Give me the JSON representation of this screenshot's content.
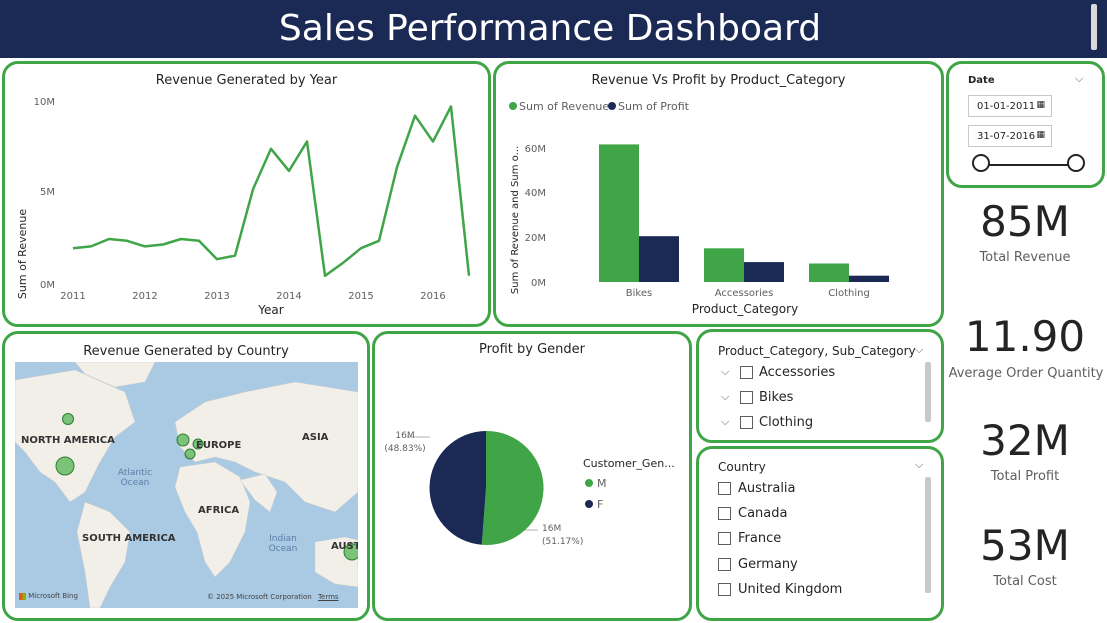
{
  "header": {
    "title": "Sales Performance Dashboard"
  },
  "colors": {
    "accent_green": "#3fa547",
    "navy": "#1b2a55",
    "border": "#3fa547"
  },
  "revenue_by_year": {
    "title": "Revenue Generated by Year",
    "xlabel": "Year",
    "ylabel": "Sum of Revenue",
    "y_ticks": [
      "0M",
      "5M",
      "10M"
    ],
    "x_ticks": [
      "2011",
      "2012",
      "2013",
      "2014",
      "2015",
      "2016"
    ]
  },
  "rev_vs_profit": {
    "title": "Revenue Vs Profit by Product_Category",
    "xlabel": "Product_Category",
    "ylabel": "Sum of Revenue and Sum o...",
    "legend": [
      "Sum of Revenue",
      "Sum of Profit"
    ],
    "y_ticks": [
      "0M",
      "20M",
      "40M",
      "60M"
    ]
  },
  "country_map": {
    "title": "Revenue Generated by Country",
    "labels": [
      "NORTH AMERICA",
      "EUROPE",
      "ASIA",
      "AFRICA",
      "SOUTH AMERICA",
      "AUST"
    ],
    "oceans": [
      "Atlantic Ocean",
      "Indian Ocean"
    ],
    "footer_brand": "Microsoft Bing",
    "footer_copyright": "© 2025 Microsoft Corporation",
    "footer_terms": "Terms"
  },
  "profit_by_gender": {
    "title": "Profit by Gender",
    "legend_title": "Customer_Gen...",
    "label_f": [
      "16M",
      "(48.83%)"
    ],
    "label_m": [
      "16M",
      "(51.17%)"
    ]
  },
  "date_slicer": {
    "title": "Date",
    "start": "01-01-2011",
    "end": "31-07-2016"
  },
  "kpis": [
    {
      "value": "85M",
      "label": "Total Revenue"
    },
    {
      "value": "11.90",
      "label": "Average Order Quantity"
    },
    {
      "value": "32M",
      "label": "Total Profit"
    },
    {
      "value": "53M",
      "label": "Total Cost"
    }
  ],
  "category_slicer": {
    "title": "Product_Category, Sub_Category",
    "items": [
      "Accessories",
      "Bikes",
      "Clothing"
    ]
  },
  "country_slicer": {
    "title": "Country",
    "items": [
      "Australia",
      "Canada",
      "France",
      "Germany",
      "United Kingdom"
    ]
  },
  "chart_data": [
    {
      "type": "line",
      "title": "Revenue Generated by Year",
      "xlabel": "Year",
      "ylabel": "Sum of Revenue",
      "xlim": [
        2011,
        2016.75
      ],
      "ylim": [
        0,
        10
      ],
      "x": [
        2011.0,
        2011.25,
        2011.5,
        2011.75,
        2012.0,
        2012.25,
        2012.5,
        2012.75,
        2013.0,
        2013.25,
        2013.5,
        2013.75,
        2014.0,
        2014.25,
        2014.5,
        2014.75,
        2015.0,
        2015.25,
        2015.5,
        2015.75,
        2016.0,
        2016.25,
        2016.5
      ],
      "series": [
        {
          "values": [
            2.0,
            2.1,
            2.5,
            2.4,
            2.1,
            2.2,
            2.5,
            2.4,
            1.4,
            1.6,
            5.2,
            7.4,
            6.2,
            7.8,
            0.5,
            1.2,
            2.0,
            2.4,
            6.4,
            9.2,
            7.8,
            9.7,
            0.5
          ]
        }
      ]
    },
    {
      "type": "bar",
      "title": "Revenue Vs Profit by Product_Category",
      "xlabel": "Product_Category",
      "ylabel": "Sum of Revenue and Sum o...",
      "categories": [
        "Bikes",
        "Accessories",
        "Clothing"
      ],
      "ylim": [
        0,
        70
      ],
      "series": [
        {
          "name": "Sum of Revenue",
          "color": "#3fa547",
          "values": [
            61.6,
            15.1,
            8.3
          ]
        },
        {
          "name": "Sum of Profit",
          "color": "#1b2a55",
          "values": [
            20.5,
            8.9,
            2.8
          ]
        }
      ]
    },
    {
      "type": "pie",
      "title": "Profit by Gender",
      "legend_title": "Customer_Gen...",
      "categories": [
        "M",
        "F"
      ],
      "values": [
        16,
        16
      ],
      "percentages": [
        51.17,
        48.83
      ],
      "colors": [
        "#3fa547",
        "#1b2a55"
      ]
    }
  ]
}
